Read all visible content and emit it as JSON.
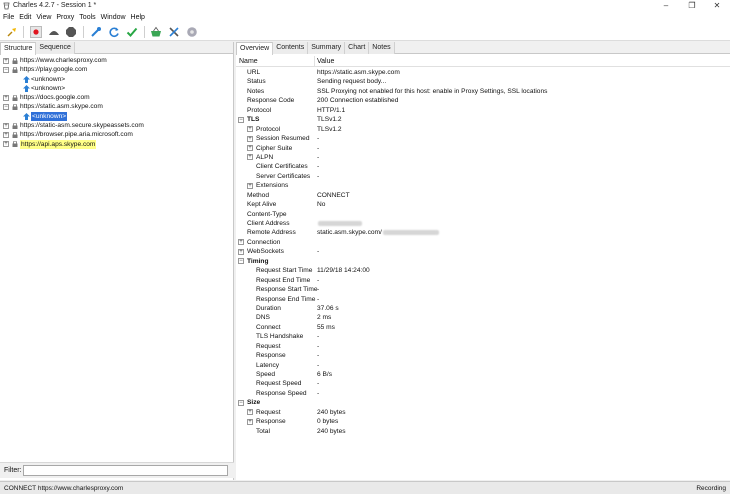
{
  "window": {
    "title": "Charles 4.2.7 - Session 1 *",
    "controls": [
      "minimize-icon",
      "restore-icon",
      "close-icon"
    ]
  },
  "menu": [
    "File",
    "Edit",
    "View",
    "Proxy",
    "Tools",
    "Window",
    "Help"
  ],
  "toolbar": {
    "icons": [
      "broom-icon",
      "record-icon",
      "throttle-icon",
      "breakpoint-icon",
      "compose-icon",
      "repeat-icon",
      "validate-icon",
      "basket-icon",
      "tools-icon",
      "settings-icon"
    ],
    "record_color": "#e0141e"
  },
  "left": {
    "tabs": [
      "Structure",
      "Sequence"
    ],
    "tree": [
      {
        "text": "https://www.charlesproxy.com",
        "expander": "+",
        "indent": 0
      },
      {
        "text": "https://play.google.com",
        "expander": "-",
        "indent": 0
      },
      {
        "text": "<unknown>",
        "indent": 1
      },
      {
        "text": "<unknown>",
        "indent": 1
      },
      {
        "text": "https://docs.google.com",
        "expander": "+",
        "indent": 0
      },
      {
        "text": "https://static.asm.skype.com",
        "expander": "-",
        "indent": 0
      },
      {
        "text": "<unknown>",
        "indent": 1,
        "selected": true
      },
      {
        "text": "https://static-asm.secure.skypeassets.com",
        "expander": "+",
        "indent": 0
      },
      {
        "text": "https://browser.pipe.aria.microsoft.com",
        "expander": "+",
        "indent": 0
      },
      {
        "text": "https://api.aps.skype.com",
        "expander": "+",
        "indent": 0,
        "highlight": true
      }
    ],
    "filter_label": "Filter:",
    "filter_value": ""
  },
  "right": {
    "tabs": [
      "Overview",
      "Contents",
      "Summary",
      "Chart",
      "Notes"
    ],
    "columns": {
      "name": "Name",
      "value": "Value"
    },
    "rows": [
      {
        "name": "URL",
        "value": "https://static.asm.skype.com"
      },
      {
        "name": "Status",
        "value": "Sending request body..."
      },
      {
        "name": "Notes",
        "value": "SSL Proxying not enabled for this host: enable in Proxy Settings, SSL locations"
      },
      {
        "name": "Response Code",
        "value": "200 Connection established"
      },
      {
        "name": "Protocol",
        "value": "HTTP/1.1"
      },
      {
        "name": "TLS",
        "value": "TLSv1.2",
        "bold": true,
        "expander": "-"
      },
      {
        "name": "Protocol",
        "value": "TLSv1.2",
        "indent": 1,
        "expander": "+"
      },
      {
        "name": "Session Resumed",
        "value": "-",
        "indent": 1,
        "expander": "+"
      },
      {
        "name": "Cipher Suite",
        "value": "-",
        "indent": 1,
        "expander": "+"
      },
      {
        "name": "ALPN",
        "value": "-",
        "indent": 1,
        "expander": "+"
      },
      {
        "name": "Client Certificates",
        "value": "-",
        "indent": 1
      },
      {
        "name": "Server Certificates",
        "value": "-",
        "indent": 1
      },
      {
        "name": "Extensions",
        "value": "",
        "indent": 1,
        "expander": "+"
      },
      {
        "name": "Method",
        "value": "CONNECT"
      },
      {
        "name": "Kept Alive",
        "value": "No"
      },
      {
        "name": "Content-Type",
        "value": ""
      },
      {
        "name": "Client Address",
        "value": "",
        "blur": 44
      },
      {
        "name": "Remote Address",
        "value": "static.asm.skype.com/",
        "blur": 56
      },
      {
        "name": "Connection",
        "value": "",
        "expander": "+",
        "root": true
      },
      {
        "name": "WebSockets",
        "value": "-",
        "expander": "+",
        "root": true
      },
      {
        "name": "Timing",
        "value": "",
        "bold": true,
        "expander": "-",
        "root": true
      },
      {
        "name": "Request Start Time",
        "value": "11/29/18 14:24:00",
        "indent": 1
      },
      {
        "name": "Request End Time",
        "value": "-",
        "indent": 1
      },
      {
        "name": "Response Start Time",
        "value": "-",
        "indent": 1
      },
      {
        "name": "Response End Time",
        "value": "-",
        "indent": 1
      },
      {
        "name": "Duration",
        "value": "37.06 s",
        "indent": 1
      },
      {
        "name": "DNS",
        "value": "2 ms",
        "indent": 1
      },
      {
        "name": "Connect",
        "value": "55 ms",
        "indent": 1
      },
      {
        "name": "TLS Handshake",
        "value": "-",
        "indent": 1
      },
      {
        "name": "Request",
        "value": "-",
        "indent": 1
      },
      {
        "name": "Response",
        "value": "-",
        "indent": 1
      },
      {
        "name": "Latency",
        "value": "-",
        "indent": 1
      },
      {
        "name": "Speed",
        "value": "6 B/s",
        "indent": 1
      },
      {
        "name": "Request Speed",
        "value": "-",
        "indent": 1
      },
      {
        "name": "Response Speed",
        "value": "-",
        "indent": 1
      },
      {
        "name": "Size",
        "value": "",
        "bold": true,
        "expander": "-",
        "root": true
      },
      {
        "name": "Request",
        "value": "240 bytes",
        "indent": 1,
        "expander": "+"
      },
      {
        "name": "Response",
        "value": "0 bytes",
        "indent": 1,
        "expander": "+"
      },
      {
        "name": "Total",
        "value": "240 bytes",
        "indent": 1
      }
    ]
  },
  "status": {
    "left": "CONNECT https://www.charlesproxy.com",
    "right": "Recording"
  }
}
